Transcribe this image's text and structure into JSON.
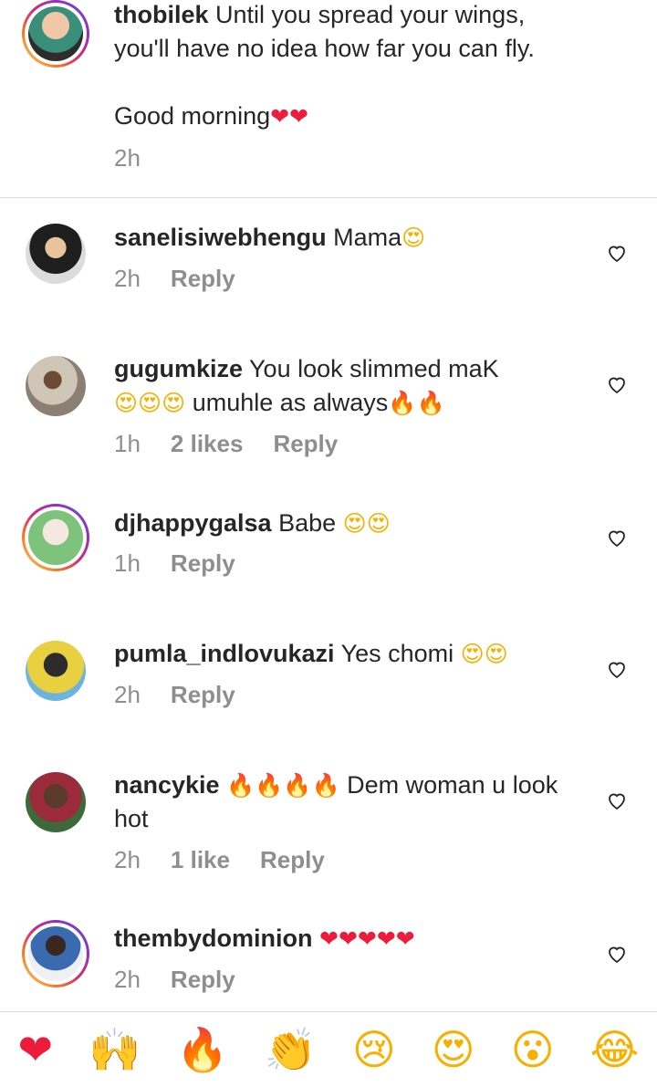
{
  "caption": {
    "username": "thobilek",
    "line1": "Until you spread your wings,",
    "line2": "you'll have no idea how far you can fly.",
    "line3": "Good morning",
    "line3_emoji": "❤❤",
    "time": "2h"
  },
  "comments": [
    {
      "username": "sanelisiwebhengu",
      "text": "Mama",
      "emoji": "😍",
      "time": "2h",
      "likes": "",
      "reply": "Reply"
    },
    {
      "username": "gugumkize",
      "text": "You look slimmed maK",
      "emoji_line2": "😍😍😍",
      "text_line2": "umuhle as always",
      "emoji_line2b": "🔥🔥",
      "time": "1h",
      "likes": "2 likes",
      "reply": "Reply"
    },
    {
      "username": "djhappygalsa",
      "text": "Babe",
      "emoji": "😍😍",
      "time": "1h",
      "likes": "",
      "reply": "Reply"
    },
    {
      "username": "pumla_indlovukazi",
      "text": "Yes chomi",
      "emoji": "😍😍",
      "time": "2h",
      "likes": "",
      "reply": "Reply"
    },
    {
      "username": "nancykie",
      "emoji": "🔥🔥🔥🔥",
      "text": "Dem woman u look",
      "text_line2": "hot",
      "time": "2h",
      "likes": "1 like",
      "reply": "Reply"
    },
    {
      "username": "thembydominion",
      "emoji": "❤❤❤❤❤",
      "time": "2h",
      "likes": "",
      "reply": "Reply"
    }
  ],
  "reaction_bar": [
    "❤",
    "🙌",
    "🔥",
    "👏",
    "😢",
    "😍",
    "😮",
    "😂"
  ],
  "colors": {
    "heart": "#ed1c3a",
    "muted": "#8e8e8e",
    "divider": "#dbdbdb"
  }
}
